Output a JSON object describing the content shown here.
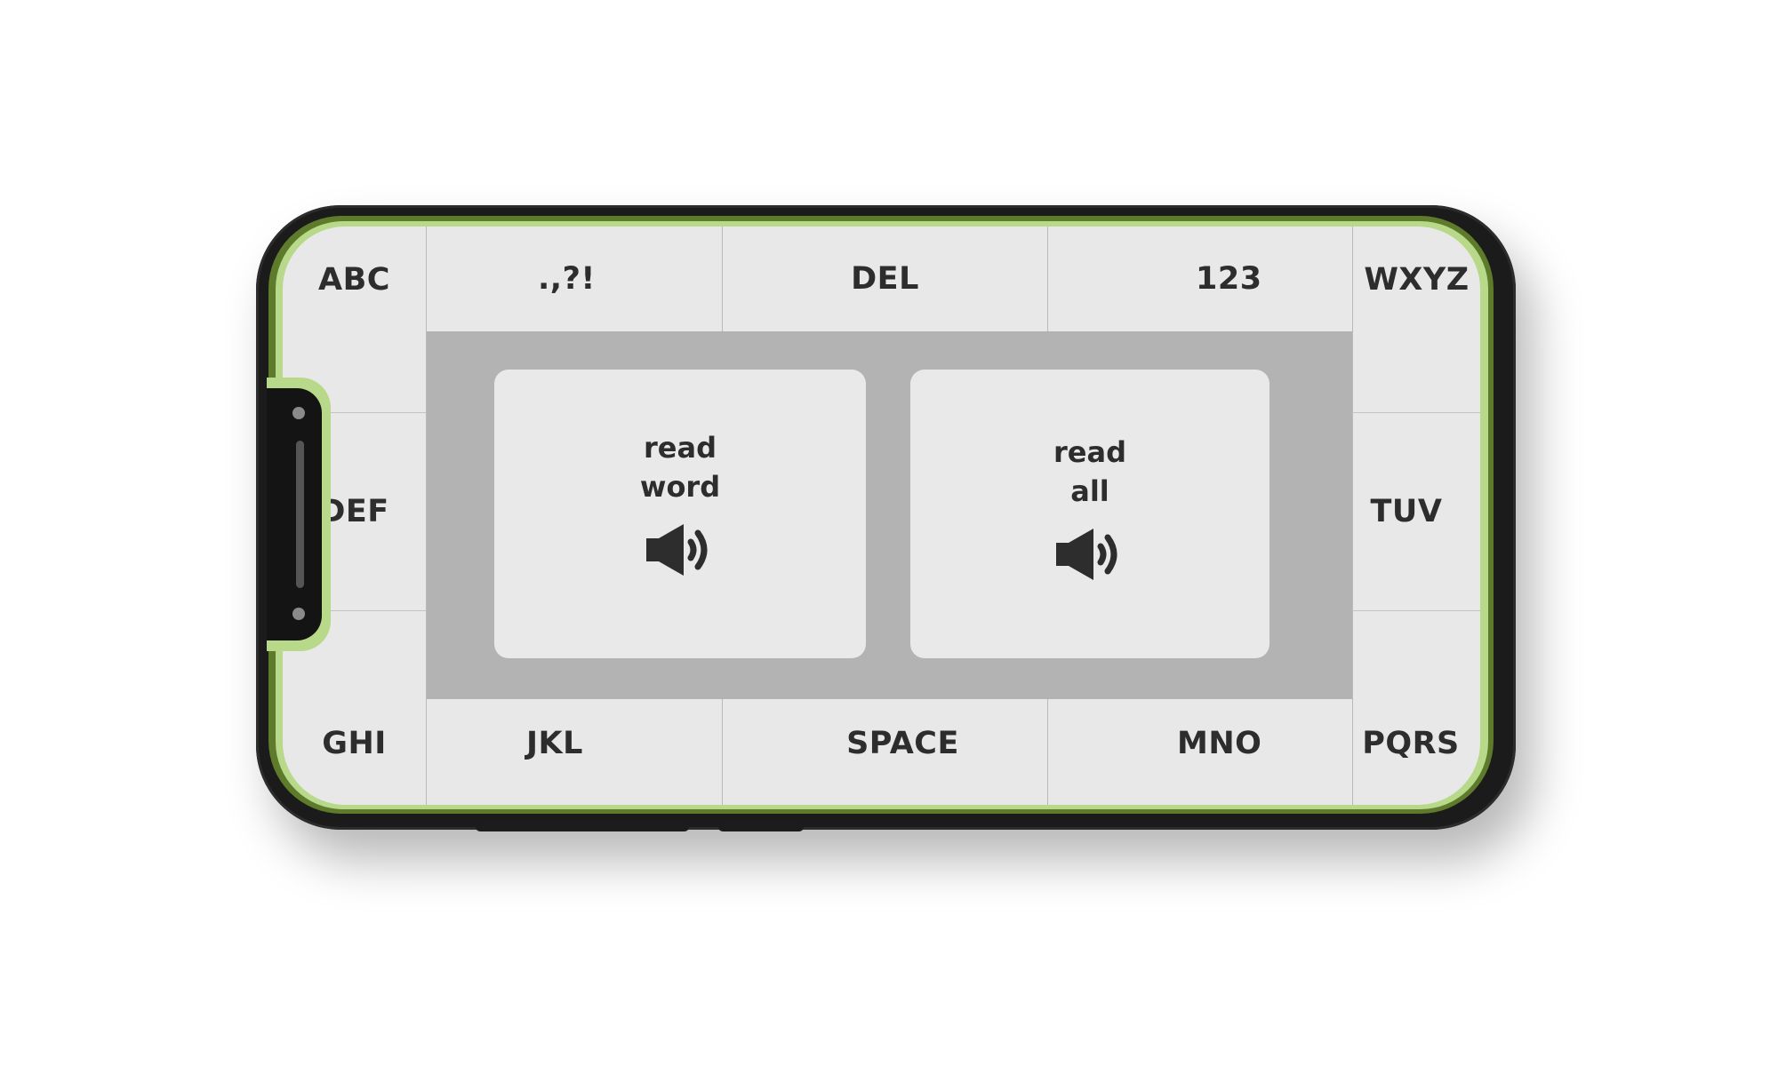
{
  "keyboard": {
    "top_left": "ABC",
    "top_punct": ".,?!",
    "top_del": "DEL",
    "top_num": "123",
    "top_right": "WXYZ",
    "left_mid": "DEF",
    "right_mid": "TUV",
    "bottom_left": "GHI",
    "bottom_jkl": "JKL",
    "bottom_space": "SPACE",
    "bottom_mno": "MNO",
    "bottom_right": "PQRS"
  },
  "read_word": {
    "line1": "read",
    "line2": "word",
    "icon": "speaker-icon"
  },
  "read_all": {
    "line1": "read",
    "line2": "all",
    "icon": "speaker-icon"
  },
  "colors": {
    "frame": "#1b1b1b",
    "bezel_accent": "#b8d98a",
    "screen_bg": "#e8e8e8",
    "center_panel": "#b3b3b3",
    "text": "#2d2d2d"
  }
}
